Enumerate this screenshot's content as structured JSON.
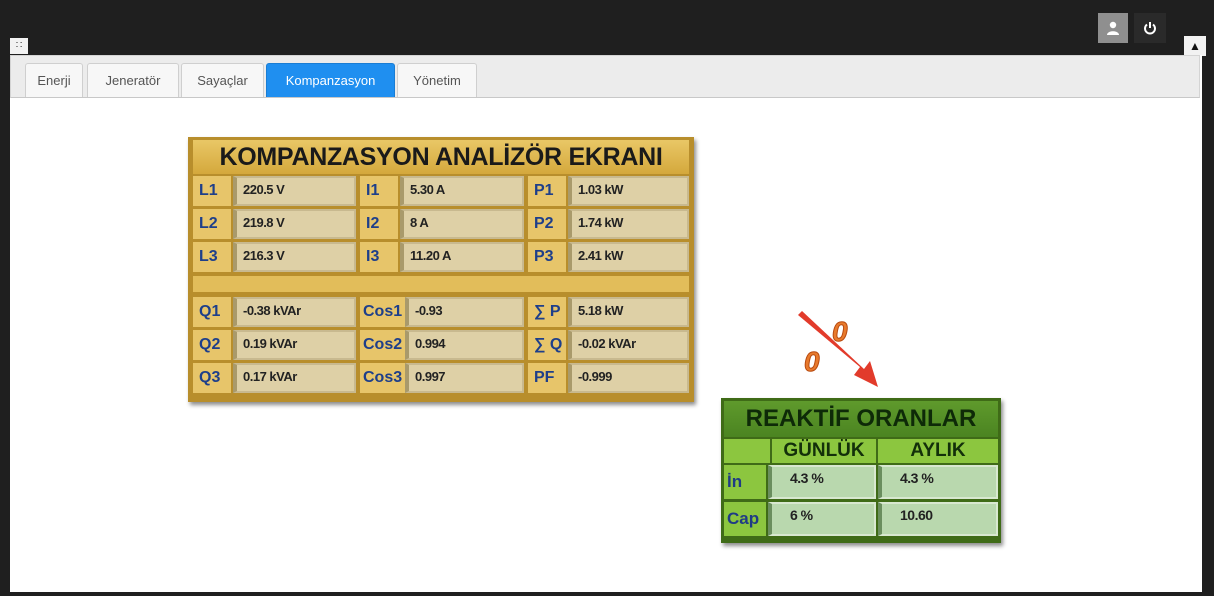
{
  "tabs": [
    {
      "label": "Enerji"
    },
    {
      "label": "Jeneratör"
    },
    {
      "label": "Sayaçlar"
    },
    {
      "label": "Kompanzasyon"
    },
    {
      "label": "Yönetim"
    }
  ],
  "active_tab": "Kompanzasyon",
  "analyzer": {
    "title": "KOMPANZASYON ANALİZÖR EKRANI",
    "rows": [
      {
        "l1": "L1",
        "v1": "220.5 V",
        "l2": "I1",
        "v2": "5.30 A",
        "l3": "P1",
        "v3": "1.03 kW"
      },
      {
        "l1": "L2",
        "v1": "219.8 V",
        "l2": "I2",
        "v2": "8 A",
        "l3": "P2",
        "v3": "1.74 kW"
      },
      {
        "l1": "L3",
        "v1": "216.3 V",
        "l2": "I3",
        "v2": "11.20 A",
        "l3": "P3",
        "v3": "2.41 kW"
      },
      {
        "l1": "Q1",
        "v1": "-0.38 kVAr",
        "l2": "Cos1",
        "v2": "-0.93",
        "l3": "∑ P",
        "v3": "5.18 kW"
      },
      {
        "l1": "Q2",
        "v1": "0.19 kVAr",
        "l2": "Cos2",
        "v2": "0.994",
        "l3": "∑ Q",
        "v3": "-0.02 kVAr"
      },
      {
        "l1": "Q3",
        "v1": "0.17 kVAr",
        "l2": "Cos3",
        "v2": "0.997",
        "l3": "PF",
        "v3": "-0.999"
      }
    ]
  },
  "reaktif": {
    "title": "REAKTİF ORANLAR",
    "col_daily": "GÜNLÜK",
    "col_monthly": "AYLIK",
    "rows": [
      {
        "label": "İn",
        "daily": "4.3 %",
        "monthly": "4.3 %"
      },
      {
        "label": "Cap",
        "daily": "6 %",
        "monthly": "10.60"
      }
    ]
  },
  "icons": {
    "grid": "grid-menu-icon",
    "user": "user-icon",
    "power": "power-icon",
    "pin": "pin-icon",
    "percent_arrow": "percent-down-arrow-icon"
  }
}
